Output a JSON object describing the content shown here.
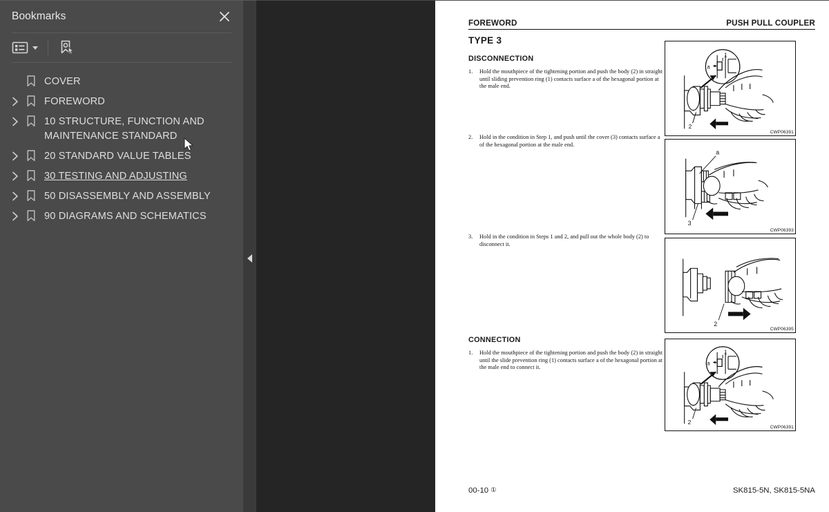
{
  "sidebar": {
    "title": "Bookmarks",
    "close_icon": "close-icon",
    "toolbar": {
      "options_icon": "bookmark-options-icon",
      "new_bookmark_icon": "new-bookmark-icon"
    },
    "items": [
      {
        "label": "COVER",
        "expandable": false,
        "hover": false
      },
      {
        "label": "FOREWORD",
        "expandable": true,
        "hover": false
      },
      {
        "label": "10 STRUCTURE, FUNCTION AND\nMAINTENANCE STANDARD",
        "expandable": true,
        "hover": false
      },
      {
        "label": "20 STANDARD VALUE TABLES",
        "expandable": true,
        "hover": false
      },
      {
        "label": "30 TESTING AND ADJUSTING",
        "expandable": true,
        "hover": true
      },
      {
        "label": "50 DISASSEMBLY AND ASSEMBLY",
        "expandable": true,
        "hover": false
      },
      {
        "label": "90 DIAGRAMS AND SCHEMATICS",
        "expandable": true,
        "hover": false
      }
    ]
  },
  "viewer": {
    "collapse_handle_icon": "collapse-left-icon"
  },
  "document": {
    "header": {
      "left": "FOREWORD",
      "right": "PUSH PULL COUPLER"
    },
    "footer": {
      "left": "00-10",
      "left_mark": "①",
      "right": "SK815-5N, SK815-5NA"
    },
    "type_title": "TYPE 3",
    "sections": [
      {
        "heading": "DISCONNECTION",
        "steps": [
          {
            "num": "1.",
            "text": "Hold the mouthpiece of the tightening portion and push the body (2) in straight until sliding prevention ring (1) contacts surface a of the hexagonal portion at the male end."
          },
          {
            "num": "2.",
            "text": "Hold in the condition in Step 1, and push until the cover (3) contacts surface a of the hexagonal portion at the male end."
          },
          {
            "num": "3.",
            "text": "Hold in the condition in Steps 1 and 2, and pull out the whole body (2) to disconnect it."
          }
        ]
      },
      {
        "heading": "CONNECTION",
        "steps": [
          {
            "num": "1.",
            "text": "Hold the mouthpiece of the tightening portion and push the body (2) in straight until the slide prevention ring (1) contacts surface a of the hexagonal portion at the male end to connect it."
          }
        ]
      }
    ],
    "figures": [
      {
        "code": "CWP06391",
        "kind": "push-detail",
        "callouts": [
          "1",
          "2",
          "a"
        ],
        "arrow": "left"
      },
      {
        "code": "CWP06393",
        "kind": "cover-push",
        "callouts": [
          "a",
          "3"
        ],
        "arrow": "left"
      },
      {
        "code": "CWP06395",
        "kind": "pull-out",
        "callouts": [
          "2"
        ],
        "arrow": "right"
      },
      {
        "code": "CWP06391",
        "kind": "push-detail",
        "callouts": [
          "1",
          "2",
          "a"
        ],
        "arrow": "left"
      }
    ]
  },
  "colors": {
    "sidebar_bg": "#4a4a4a",
    "gutter_bg": "#3a3a3a",
    "viewer_bg": "#252525",
    "page_bg": "#ffffff",
    "text": "#dedede"
  }
}
